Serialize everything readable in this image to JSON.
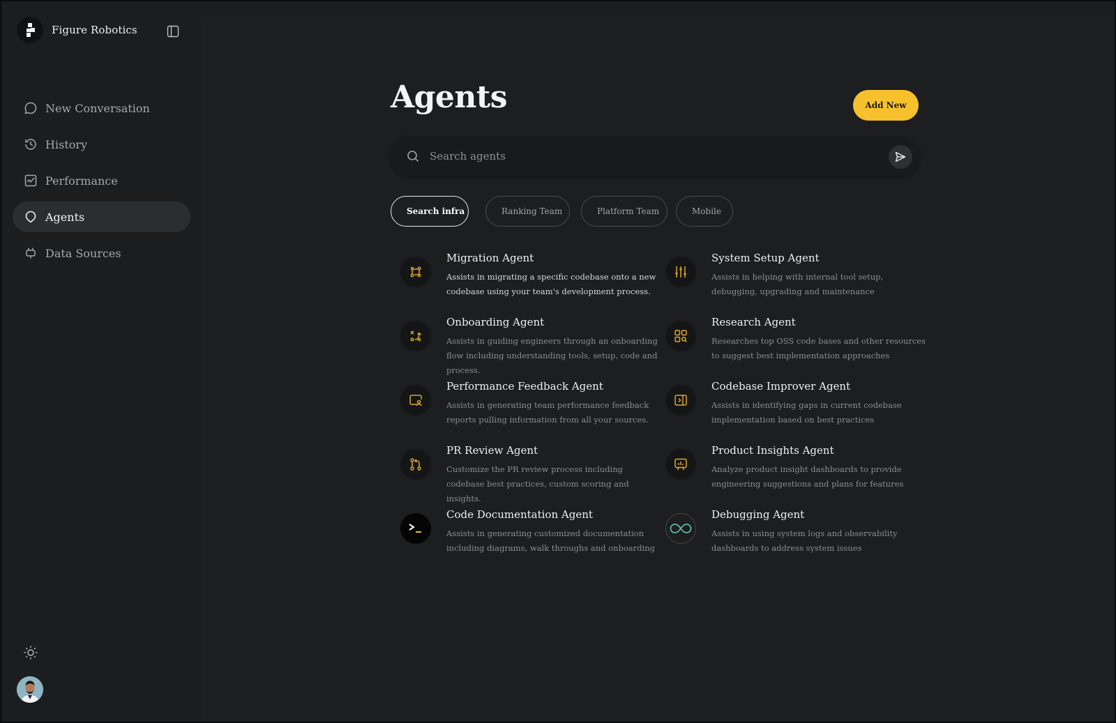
{
  "brand": {
    "name": "Figure Robotics"
  },
  "sidebar": {
    "items": [
      {
        "label": "New Conversation",
        "icon": "chat-bubble-icon",
        "active": false
      },
      {
        "label": "History",
        "icon": "history-icon",
        "active": false
      },
      {
        "label": "Performance",
        "icon": "performance-chart-icon",
        "active": false
      },
      {
        "label": "Agents",
        "icon": "agent-bubble-icon",
        "active": true
      },
      {
        "label": "Data Sources",
        "icon": "plug-icon",
        "active": false
      }
    ]
  },
  "header": {
    "title": "Agents",
    "add_label": "Add New"
  },
  "search": {
    "placeholder": "Search agents"
  },
  "filters": [
    {
      "label": "Search infra",
      "active": true
    },
    {
      "label": "Ranking Team",
      "active": false
    },
    {
      "label": "Platform Team",
      "active": false
    },
    {
      "label": "Mobile",
      "active": false
    }
  ],
  "agents": [
    {
      "name": "Migration Agent",
      "desc": "Assists in migrating a specific codebase onto a new codebase using your team's development process.",
      "icon": "migration-arrows-icon"
    },
    {
      "name": "System Setup Agent",
      "desc": "Assists in helping with internal tool setup, debugging, upgrading and maintenance",
      "icon": "sliders-icon"
    },
    {
      "name": "Onboarding Agent",
      "desc": "Assists in guiding engineers through an onboarding flow including understanding tools, setup, code and process.",
      "icon": "strategy-icon"
    },
    {
      "name": "Research Agent",
      "desc": "Researches top OSS code bases and other resources to suggest best implementation approaches",
      "icon": "grid-search-icon"
    },
    {
      "name": "Performance Feedback Agent",
      "desc": "Assists in generating team performance feedback reports pulling information from all your sources.",
      "icon": "screen-user-icon"
    },
    {
      "name": "Codebase Improver Agent",
      "desc": "Assists in identifying gaps in current codebase implementation based on best practices",
      "icon": "code-panel-icon"
    },
    {
      "name": "PR Review Agent",
      "desc": "Customize the PR review process including codebase best practices, custom scoring and insights.",
      "icon": "git-pull-request-icon"
    },
    {
      "name": "Product Insights Agent",
      "desc": "Analyze product insight dashboards to provide engineering suggestions and plans for features",
      "icon": "presentation-chart-icon"
    },
    {
      "name": "Code Documentation Agent",
      "desc": "Assists in generating customized documentation including diagrams, walk throughs and onboarding",
      "icon": "terminal-icon"
    },
    {
      "name": "Debugging Agent",
      "desc": "Assists in using system logs and observability dashboards to address system issues",
      "icon": "infinity-icon"
    }
  ],
  "colors": {
    "accent": "#f6c12c",
    "background": "#1d1e20",
    "sidebar": "#1c1d1f",
    "icon_teal": "#5fb3a3"
  }
}
